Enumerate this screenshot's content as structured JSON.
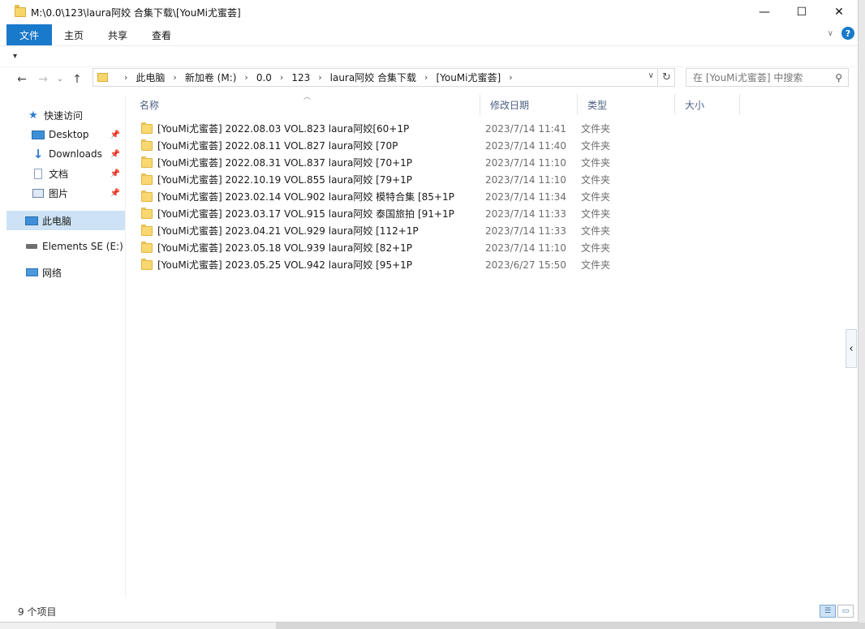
{
  "window": {
    "title": "M:\\0.0\\123\\laura阿姣 合集下载\\[YouMi尤蜜荟]",
    "controls": {
      "minimize": "—",
      "maximize": "☐",
      "close": "✕"
    }
  },
  "ribbon": {
    "tabs": [
      "文件",
      "主页",
      "共享",
      "查看"
    ],
    "expand_icon": "chevron-down-icon",
    "help": "?"
  },
  "qat": {
    "dropdown": "▾"
  },
  "nav": {
    "back": "←",
    "forward": "→",
    "recent": "⌄",
    "up": "↑",
    "breadcrumbs": [
      "此电脑",
      "新加卷 (M:)",
      "0.0",
      "123",
      "laura阿姣 合集下载",
      "[YouMi尤蜜荟]"
    ],
    "search_placeholder": "在 [YouMi尤蜜荟] 中搜索"
  },
  "sidebar": {
    "items": [
      {
        "label": "快速访问",
        "icon": "star-icon",
        "pinned": false
      },
      {
        "label": "Desktop",
        "icon": "desktop-icon",
        "pinned": true
      },
      {
        "label": "Downloads",
        "icon": "download-icon",
        "pinned": true
      },
      {
        "label": "文档",
        "icon": "document-icon",
        "pinned": true
      },
      {
        "label": "图片",
        "icon": "picture-icon",
        "pinned": true
      },
      {
        "label": "此电脑",
        "icon": "computer-icon",
        "pinned": false
      },
      {
        "label": "Elements SE (E:)",
        "icon": "drive-icon",
        "pinned": false
      },
      {
        "label": "网络",
        "icon": "network-icon",
        "pinned": false
      }
    ]
  },
  "columns": {
    "name": "名称",
    "modified": "修改日期",
    "type": "类型",
    "size": "大小"
  },
  "files": [
    {
      "name": "[YouMi尤蜜荟] 2022.08.03 VOL.823 laura阿姣[60+1P",
      "modified": "2023/7/14 11:41",
      "type": "文件夹"
    },
    {
      "name": "[YouMi尤蜜荟] 2022.08.11 VOL.827 laura阿姣 [70P",
      "modified": "2023/7/14 11:40",
      "type": "文件夹"
    },
    {
      "name": "[YouMi尤蜜荟] 2022.08.31 VOL.837 laura阿姣 [70+1P",
      "modified": "2023/7/14 11:10",
      "type": "文件夹"
    },
    {
      "name": "[YouMi尤蜜荟] 2022.10.19 VOL.855 laura阿姣 [79+1P",
      "modified": "2023/7/14 11:10",
      "type": "文件夹"
    },
    {
      "name": "[YouMi尤蜜荟] 2023.02.14 VOL.902 laura阿姣 模特合集 [85+1P",
      "modified": "2023/7/14 11:34",
      "type": "文件夹"
    },
    {
      "name": "[YouMi尤蜜荟] 2023.03.17 VOL.915 laura阿姣 泰国旅拍 [91+1P",
      "modified": "2023/7/14 11:33",
      "type": "文件夹"
    },
    {
      "name": "[YouMi尤蜜荟] 2023.04.21 VOL.929 laura阿姣 [112+1P",
      "modified": "2023/7/14 11:33",
      "type": "文件夹"
    },
    {
      "name": "[YouMi尤蜜荟] 2023.05.18 VOL.939 laura阿姣 [82+1P",
      "modified": "2023/7/14 11:10",
      "type": "文件夹"
    },
    {
      "name": "[YouMi尤蜜荟] 2023.05.25 VOL.942 laura阿姣 [95+1P",
      "modified": "2023/6/27 15:50",
      "type": "文件夹"
    }
  ],
  "status": {
    "count": "9 个项目"
  },
  "pane_toggle": "‹",
  "colors": {
    "accent": "#1979ca",
    "selected": "#cde3f5",
    "header_text": "#4d6082",
    "folder": "#f9d771"
  }
}
